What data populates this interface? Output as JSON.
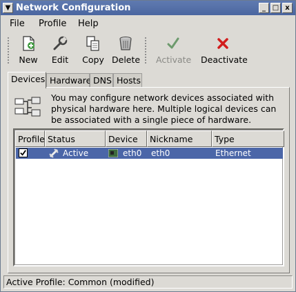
{
  "window": {
    "title": "Network Configuration",
    "controls": {
      "minimize": "_",
      "maximize": "□",
      "close": "x"
    }
  },
  "menubar": {
    "items": [
      {
        "label": "File"
      },
      {
        "label": "Profile"
      },
      {
        "label": "Help"
      }
    ]
  },
  "toolbar": {
    "buttons": [
      {
        "label": "New",
        "icon": "new-icon",
        "enabled": true
      },
      {
        "label": "Edit",
        "icon": "wrench-icon",
        "enabled": true
      },
      {
        "label": "Copy",
        "icon": "copy-icon",
        "enabled": true
      },
      {
        "label": "Delete",
        "icon": "trash-icon",
        "enabled": true
      },
      {
        "label": "Activate",
        "icon": "checkmark-icon",
        "enabled": false
      },
      {
        "label": "Deactivate",
        "icon": "red-x-icon",
        "enabled": true
      }
    ]
  },
  "tabs": [
    {
      "label": "Devices",
      "active": true
    },
    {
      "label": "Hardware",
      "active": false
    },
    {
      "label": "DNS",
      "active": false
    },
    {
      "label": "Hosts",
      "active": false
    }
  ],
  "devices_panel": {
    "description": "You may configure network devices associated with physical hardware here.  Multiple logical devices can be associated with a single piece of hardware.",
    "columns": [
      "Profile",
      "Status",
      "Device",
      "Nickname",
      "Type"
    ],
    "rows": [
      {
        "profile_checked": true,
        "status": "Active",
        "device": "eth0",
        "nickname": "eth0",
        "type": "Ethernet",
        "selected": true
      }
    ]
  },
  "statusbar": {
    "text": "Active Profile: Common (modified)"
  },
  "colors": {
    "title_bar": "#5f7ab0",
    "selection": "#4b66a8",
    "window_bg": "#dcdad5"
  }
}
